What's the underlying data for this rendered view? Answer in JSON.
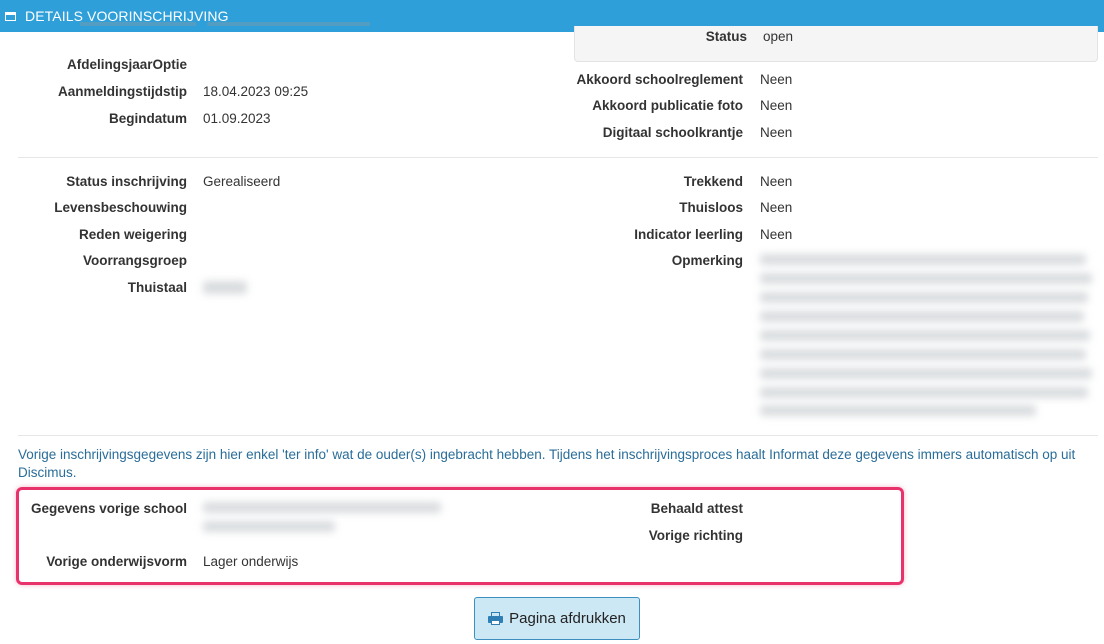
{
  "window": {
    "title": "DETAILS VOORINSCHRIJVING",
    "icon": "window-icon"
  },
  "top": {
    "status_label": "Status",
    "status_value": "open",
    "afdelingsjaar_label": "AfdelingsjaarOptie",
    "aanmelding_label": "Aanmeldingstijdstip",
    "aanmelding_value": "18.04.2023 09:25",
    "begindatum_label": "Begindatum",
    "begindatum_value": "01.09.2023",
    "akkoord_schoolreglement_label": "Akkoord schoolreglement",
    "akkoord_schoolreglement_value": "Neen",
    "akkoord_foto_label": "Akkoord publicatie foto",
    "akkoord_foto_value": "Neen",
    "digitaal_label": "Digitaal schoolkrantje",
    "digitaal_value": "Neen"
  },
  "middle": {
    "status_inschrijving_label": "Status inschrijving",
    "status_inschrijving_value": "Gerealiseerd",
    "levensbeschouwing_label": "Levensbeschouwing",
    "reden_label": "Reden weigering",
    "voorrang_label": "Voorrangsgroep",
    "thuistaal_label": "Thuistaal",
    "trekkend_label": "Trekkend",
    "trekkend_value": "Neen",
    "thuisloos_label": "Thuisloos",
    "thuisloos_value": "Neen",
    "indicator_label": "Indicator leerling",
    "indicator_value": "Neen",
    "opmerking_label": "Opmerking"
  },
  "info_text": "Vorige inschrijvingsgegevens zijn hier enkel 'ter info' wat de ouder(s) ingebracht hebben. Tijdens het inschrijvingsproces haalt Informat deze gegevens immers automatisch op uit Discimus.",
  "previous": {
    "school_label": "Gegevens vorige school",
    "onderwijsvorm_label": "Vorige onderwijsvorm",
    "onderwijsvorm_value": "Lager onderwijs",
    "attest_label": "Behaald attest",
    "richting_label": "Vorige richting"
  },
  "print_button": {
    "label": "Pagina afdrukken",
    "icon": "print-icon"
  },
  "colors": {
    "header": "#2f9fd9",
    "highlight": "#e8326b",
    "info_text": "#2a6d99",
    "button_bg": "#cde8f5"
  }
}
